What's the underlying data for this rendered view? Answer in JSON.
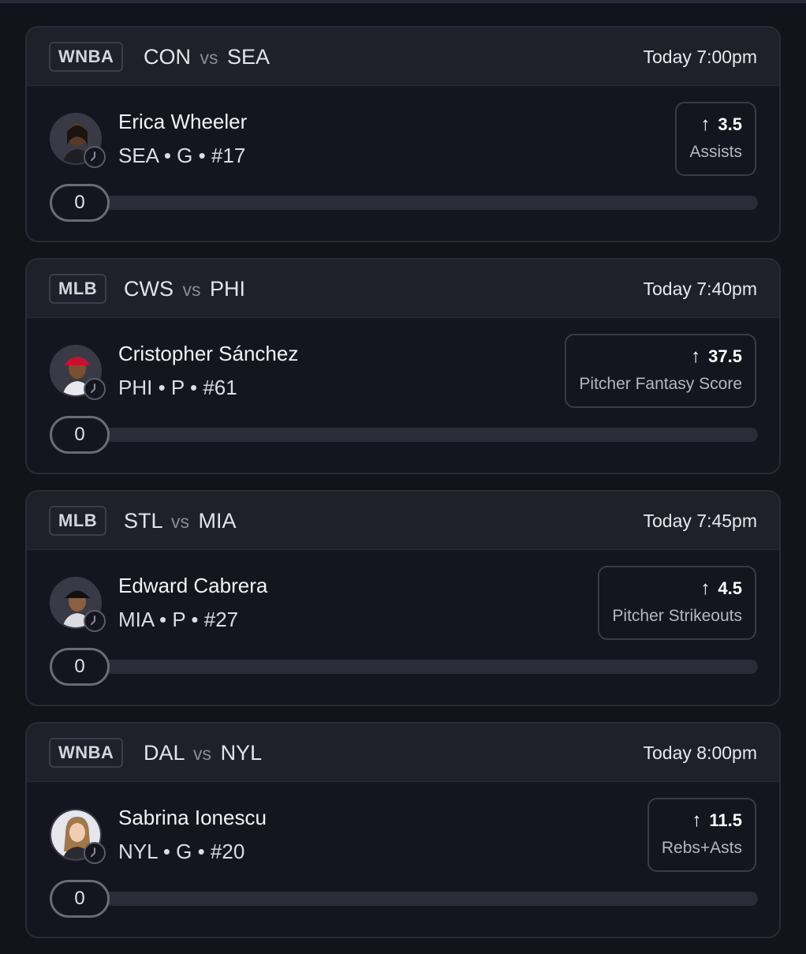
{
  "cards": [
    {
      "league": "WNBA",
      "home": "CON",
      "vs": "vs",
      "away": "SEA",
      "time": "Today 7:00pm",
      "player": {
        "name": "Erica Wheeler",
        "meta": "SEA • G • #17",
        "avatar_icon": "player-headshot-icon"
      },
      "prop": {
        "arrow": "↑",
        "line": "3.5",
        "stat": "Assists"
      },
      "progress": {
        "value": "0",
        "fraction": 0
      }
    },
    {
      "league": "MLB",
      "home": "CWS",
      "vs": "vs",
      "away": "PHI",
      "time": "Today 7:40pm",
      "player": {
        "name": "Cristopher Sánchez",
        "meta": "PHI • P • #61",
        "avatar_icon": "player-headshot-icon"
      },
      "prop": {
        "arrow": "↑",
        "line": "37.5",
        "stat": "Pitcher Fantasy Score"
      },
      "progress": {
        "value": "0",
        "fraction": 0
      }
    },
    {
      "league": "MLB",
      "home": "STL",
      "vs": "vs",
      "away": "MIA",
      "time": "Today 7:45pm",
      "player": {
        "name": "Edward Cabrera",
        "meta": "MIA • P • #27",
        "avatar_icon": "player-headshot-icon"
      },
      "prop": {
        "arrow": "↑",
        "line": "4.5",
        "stat": "Pitcher Strikeouts"
      },
      "progress": {
        "value": "0",
        "fraction": 0
      }
    },
    {
      "league": "WNBA",
      "home": "DAL",
      "vs": "vs",
      "away": "NYL",
      "time": "Today 8:00pm",
      "player": {
        "name": "Sabrina Ionescu",
        "meta": "NYL • G • #20",
        "avatar_icon": "player-headshot-icon"
      },
      "prop": {
        "arrow": "↑",
        "line": "11.5",
        "stat": "Rebs+Asts"
      },
      "progress": {
        "value": "0",
        "fraction": 0
      }
    }
  ],
  "colors": {
    "background": "#13131c",
    "card_header": "#20202b",
    "card_border": "#2b2b37",
    "progress_track": "#2c2c38"
  }
}
